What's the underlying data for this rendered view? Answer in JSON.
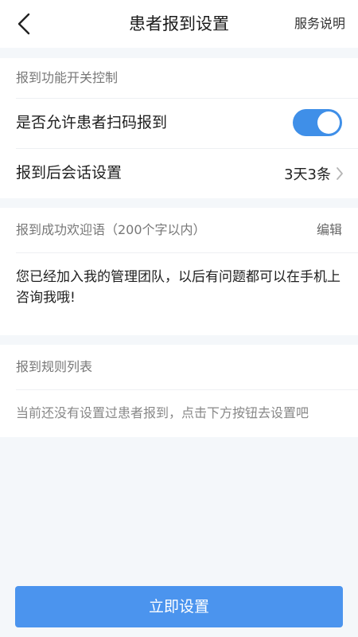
{
  "header": {
    "title": "患者报到设置",
    "service_link": "服务说明"
  },
  "switch_section": {
    "label": "报到功能开关控制",
    "allow_scan_label": "是否允许患者扫码报到",
    "allow_scan_enabled": true,
    "session_label": "报到后会话设置",
    "session_value": "3天3条"
  },
  "welcome_section": {
    "label": "报到成功欢迎语（200个字以内）",
    "edit_label": "编辑",
    "message": "您已经加入我的管理团队，以后有问题都可以在手机上咨询我哦!"
  },
  "rules_section": {
    "label": "报到规则列表",
    "empty_tip": "当前还没有设置过患者报到，点击下方按钮去设置吧"
  },
  "actions": {
    "primary_label": "立即设置"
  },
  "colors": {
    "accent": "#3f8fe8",
    "button": "#4b94ee",
    "background": "#f4f7fa"
  },
  "icons": {
    "back": "chevron-left-icon",
    "session_arrow": "chevron-right-icon"
  }
}
